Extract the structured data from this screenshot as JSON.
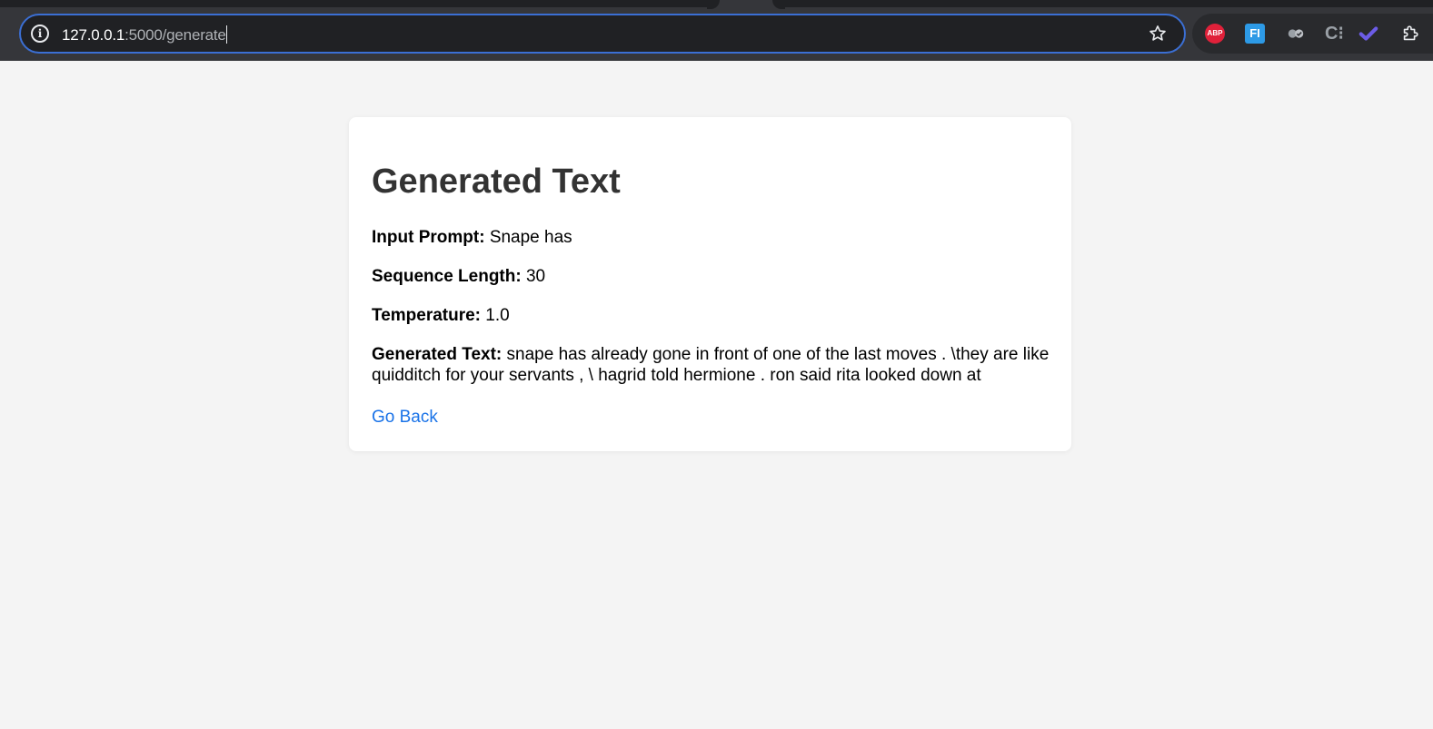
{
  "browser": {
    "url_host": "127.0.0.1",
    "url_path": ":5000/generate",
    "extensions": {
      "abp_label": "ABP",
      "fi_label": "FI",
      "c_label": "C⁝"
    }
  },
  "page": {
    "title": "Generated Text",
    "fields": {
      "prompt_label": "Input Prompt:",
      "prompt_value": "Snape has",
      "sequence_label": "Sequence Length:",
      "sequence_value": "30",
      "temperature_label": "Temperature:",
      "temperature_value": "1.0",
      "generated_label": "Generated Text:",
      "generated_value": "snape has already gone in front of one of the last moves . \\they are like quidditch for your servants , \\ hagrid told hermione . ron said rita looked down at"
    },
    "back_link": "Go Back"
  },
  "colors": {
    "accent_link": "#1a73e8",
    "omnibox_focus": "#3b6fd4",
    "page_background": "#f4f4f4"
  }
}
